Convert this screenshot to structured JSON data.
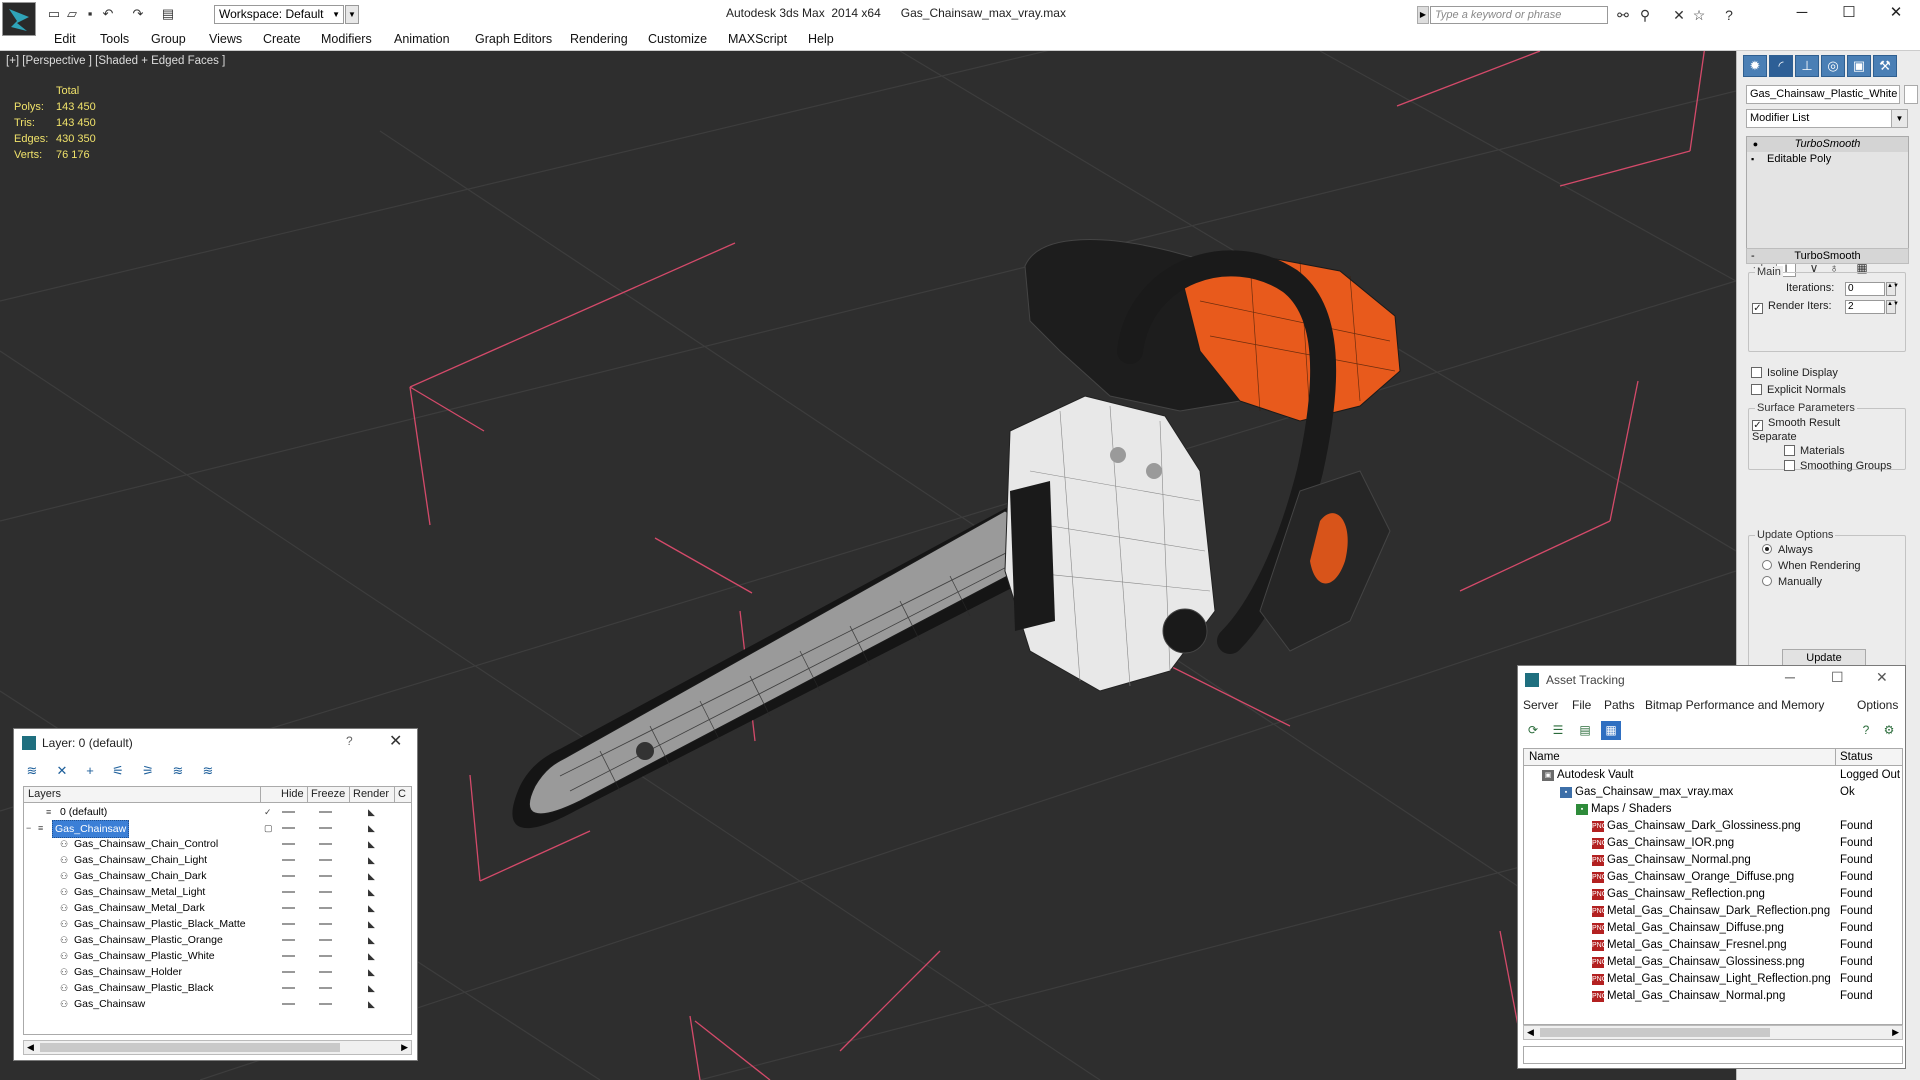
{
  "titlebar": {
    "workspace_label": "Workspace: Default",
    "app_title": "Autodesk 3ds Max  2014 x64      Gas_Chainsaw_max_vray.max",
    "search_placeholder": "Type a keyword or phrase",
    "minimize": "─",
    "maximize": "☐",
    "close": "✕"
  },
  "menu": [
    "Edit",
    "Tools",
    "Group",
    "Views",
    "Create",
    "Modifiers",
    "Animation",
    "Graph Editors",
    "Rendering",
    "Customize",
    "MAXScript",
    "Help"
  ],
  "viewport": {
    "label": "[+] [Perspective ] [Shaded + Edged Faces ]",
    "stats_header": "Total",
    "stats": [
      {
        "label": "Polys:",
        "value": "143 450"
      },
      {
        "label": "Tris:",
        "value": "143 450"
      },
      {
        "label": "Edges:",
        "value": "430 350"
      },
      {
        "label": "Verts:",
        "value": "76 176"
      }
    ]
  },
  "command_panel": {
    "object_name": "Gas_Chainsaw_Plastic_White",
    "modifier_list": "Modifier List",
    "stack": [
      "TurboSmooth",
      "Editable Poly"
    ],
    "rollout_title": "TurboSmooth",
    "main_group": "Main",
    "iterations_label": "Iterations:",
    "iterations_value": "0",
    "render_iters_label": "Render Iters:",
    "render_iters_value": "2",
    "isoline_label": "Isoline Display",
    "explicit_normals_label": "Explicit Normals",
    "surface_group": "Surface Parameters",
    "smooth_result_label": "Smooth Result",
    "separate_label": "Separate",
    "materials_label": "Materials",
    "smoothing_groups_label": "Smoothing Groups",
    "update_group": "Update Options",
    "always_label": "Always",
    "when_rendering_label": "When Rendering",
    "manually_label": "Manually",
    "update_button": "Update"
  },
  "layer_dialog": {
    "title": "Layer: 0 (default)",
    "help": "?",
    "close": "✕",
    "columns": [
      "Layers",
      "Hide",
      "Freeze",
      "Render",
      "C"
    ],
    "rows": [
      {
        "name": "0 (default)"
      },
      {
        "name": "Gas_Chainsaw"
      },
      {
        "name": "Gas_Chainsaw_Chain_Control"
      },
      {
        "name": "Gas_Chainsaw_Chain_Light"
      },
      {
        "name": "Gas_Chainsaw_Chain_Dark"
      },
      {
        "name": "Gas_Chainsaw_Metal_Light"
      },
      {
        "name": "Gas_Chainsaw_Metal_Dark"
      },
      {
        "name": "Gas_Chainsaw_Plastic_Black_Matte"
      },
      {
        "name": "Gas_Chainsaw_Plastic_Orange"
      },
      {
        "name": "Gas_Chainsaw_Plastic_White"
      },
      {
        "name": "Gas_Chainsaw_Holder"
      },
      {
        "name": "Gas_Chainsaw_Plastic_Black"
      },
      {
        "name": "Gas_Chainsaw"
      }
    ]
  },
  "asset_dialog": {
    "title": "Asset Tracking",
    "menu": [
      "Server",
      "File",
      "Paths",
      "Bitmap Performance and Memory",
      "Options"
    ],
    "columns": [
      "Name",
      "Status"
    ],
    "rows": [
      {
        "name": "Autodesk Vault",
        "status": "Logged Out"
      },
      {
        "name": "Gas_Chainsaw_max_vray.max",
        "status": "Ok"
      },
      {
        "name": "Maps / Shaders",
        "status": ""
      },
      {
        "name": "Gas_Chainsaw_Dark_Glossiness.png",
        "status": "Found"
      },
      {
        "name": "Gas_Chainsaw_IOR.png",
        "status": "Found"
      },
      {
        "name": "Gas_Chainsaw_Normal.png",
        "status": "Found"
      },
      {
        "name": "Gas_Chainsaw_Orange_Diffuse.png",
        "status": "Found"
      },
      {
        "name": "Gas_Chainsaw_Reflection.png",
        "status": "Found"
      },
      {
        "name": "Metal_Gas_Chainsaw_Dark_Reflection.png",
        "status": "Found"
      },
      {
        "name": "Metal_Gas_Chainsaw_Diffuse.png",
        "status": "Found"
      },
      {
        "name": "Metal_Gas_Chainsaw_Fresnel.png",
        "status": "Found"
      },
      {
        "name": "Metal_Gas_Chainsaw_Glossiness.png",
        "status": "Found"
      },
      {
        "name": "Metal_Gas_Chainsaw_Light_Reflection.png",
        "status": "Found"
      },
      {
        "name": "Metal_Gas_Chainsaw_Normal.png",
        "status": "Found"
      }
    ]
  },
  "colors": {
    "viewport_bg": "#2e2e2e",
    "stats_text": "#f0e26a",
    "chainsaw_orange": "#e85a1c",
    "selection_blue": "#3b7fd6",
    "grid_pink": "#d44a6a"
  }
}
